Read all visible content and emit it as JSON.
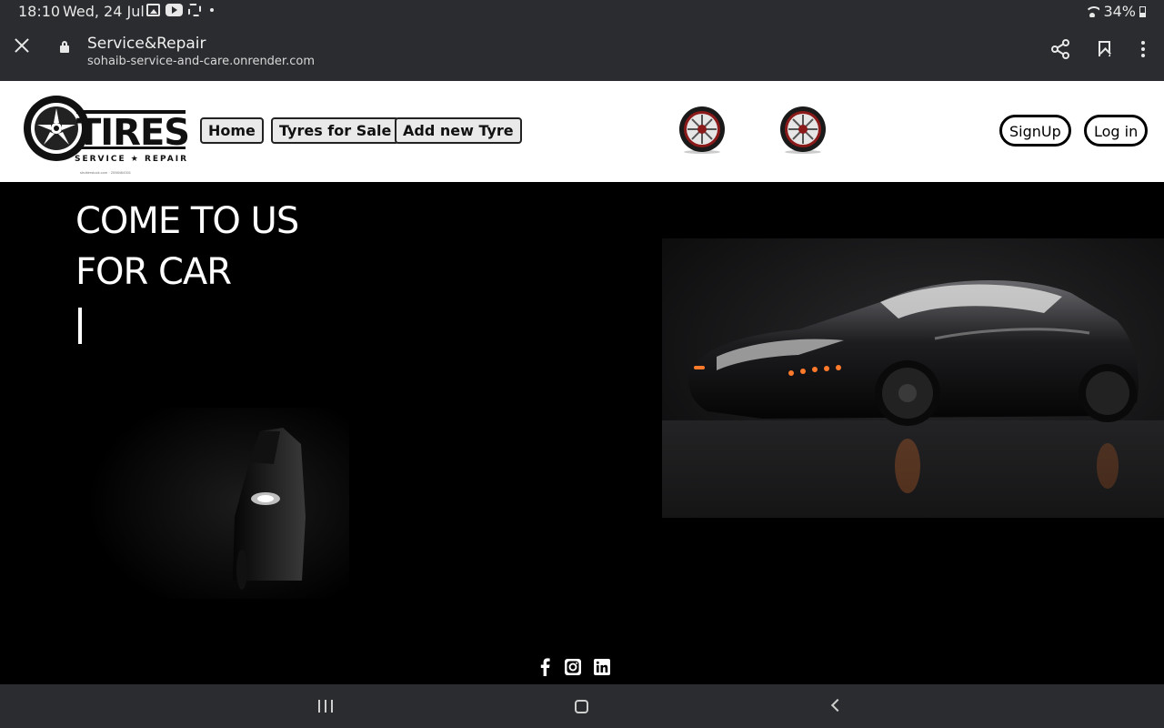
{
  "status_bar": {
    "time": "18:10",
    "date": "Wed, 24 Jul",
    "battery": "34%"
  },
  "browser": {
    "page_title": "Service&Repair",
    "url": "sohaib-service-and-care.onrender.com"
  },
  "site": {
    "logo": {
      "word": "TIRES",
      "tagline": "SERVICE ★ REPAIR",
      "credit": "shutterstock.com · 2098464301"
    },
    "nav": {
      "home": "Home",
      "tyres_for_sale": "Tyres for Sale",
      "add_new_tyre": "Add new Tyre"
    },
    "auth": {
      "signup": "SignUp",
      "login": "Log in"
    },
    "hero": {
      "line1": "COME TO US",
      "line2": "FOR CAR"
    },
    "social": [
      "facebook-icon",
      "instagram-icon",
      "linkedin-icon"
    ]
  },
  "colors": {
    "chrome_bg": "#2b2c2f",
    "navbar_bg": "#ffffff",
    "hero_bg": "#000000",
    "wheel_accent": "#8b1a1a"
  }
}
